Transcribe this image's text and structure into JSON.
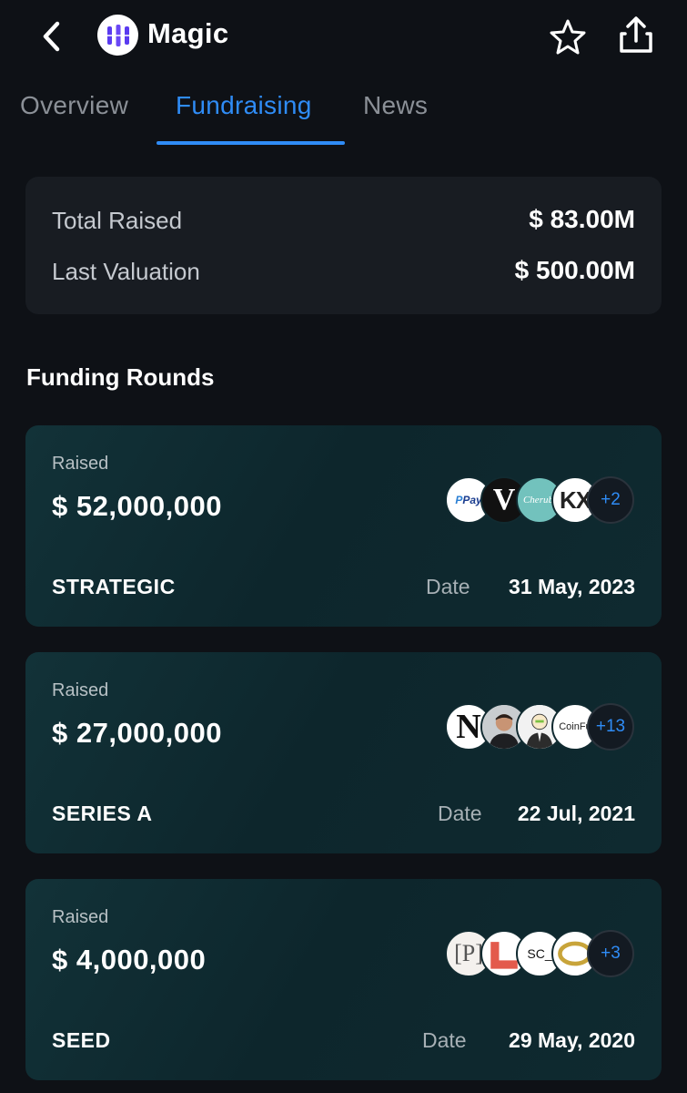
{
  "header": {
    "title": "Magic"
  },
  "tabs": [
    {
      "label": "Overview"
    },
    {
      "label": "Fundraising"
    },
    {
      "label": "News"
    }
  ],
  "summary": {
    "total_raised_label": "Total Raised",
    "total_raised_value": "$ 83.00M",
    "last_valuation_label": "Last Valuation",
    "last_valuation_value": "$ 500.00M"
  },
  "section_title": "Funding Rounds",
  "rounds": [
    {
      "raised_label": "Raised",
      "amount": "$ 52,000,000",
      "name": "STRATEGIC",
      "date_label": "Date",
      "date": "31 May, 2023",
      "investors": [
        {
          "logo": "paypal-logo",
          "text": "PayP"
        },
        {
          "logo": "v-logo",
          "text": "V"
        },
        {
          "logo": "cherubic-logo",
          "text": "Cherubi"
        },
        {
          "logo": "kx-logo",
          "text": "KX"
        }
      ],
      "more": "+2"
    },
    {
      "raised_label": "Raised",
      "amount": "$ 27,000,000",
      "name": "SERIES A",
      "date_label": "Date",
      "date": "22 Jul, 2021",
      "investors": [
        {
          "logo": "n-logo",
          "text": "N"
        },
        {
          "logo": "person-avatar"
        },
        {
          "logo": "person-sketch-avatar"
        },
        {
          "logo": "coinfund-logo",
          "text": "CoinFun"
        }
      ],
      "more": "+13"
    },
    {
      "raised_label": "Raised",
      "amount": "$ 4,000,000",
      "name": "SEED",
      "date_label": "Date",
      "date": "29 May, 2020",
      "investors": [
        {
          "logo": "p-bracket-logo",
          "text": "[P]"
        },
        {
          "logo": "red-l-logo"
        },
        {
          "logo": "sc-logo",
          "text": "SC_"
        },
        {
          "logo": "gold-ring-logo"
        }
      ],
      "more": "+3"
    }
  ],
  "colors": {
    "background": "#0e1116",
    "accent": "#2f8cf6",
    "card": "#181c22",
    "round_card": "#0f2a30"
  }
}
